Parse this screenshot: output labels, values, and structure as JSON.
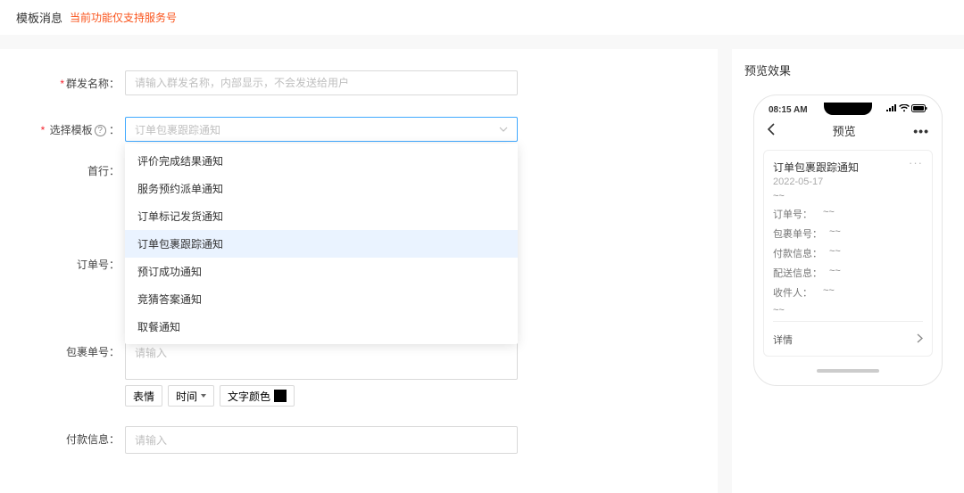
{
  "header": {
    "title": "模板消息",
    "note": "当前功能仅支持服务号"
  },
  "form": {
    "name_label": "群发名称：",
    "name_placeholder": "请输入群发名称，内部显示，不会发送给用户",
    "template_label": "选择模板",
    "template_placeholder": "订单包裹跟踪通知",
    "firstline_label": "首行：",
    "orderno_label": "订单号：",
    "packageno_label": "包裹单号：",
    "payment_label": "付款信息：",
    "textarea_placeholder": "请输入",
    "toolbar": {
      "emoji": "表情",
      "time": "时间",
      "color": "文字颜色"
    }
  },
  "dropdown": {
    "items": [
      {
        "label": "评价完成结果通知"
      },
      {
        "label": "服务预约派单通知"
      },
      {
        "label": "订单标记发货通知"
      },
      {
        "label": "订单包裹跟踪通知",
        "selected": true
      },
      {
        "label": "预订成功通知"
      },
      {
        "label": "竞猜答案通知"
      },
      {
        "label": "取餐通知"
      }
    ]
  },
  "preview": {
    "panel_title": "预览效果",
    "status_time": "08:15 AM",
    "top_title": "预览",
    "card_title": "订单包裹跟踪通知",
    "card_date": "2022-05-17",
    "tilde": "~~",
    "rows": [
      {
        "k": "订单号：",
        "v": "~~"
      },
      {
        "k": "包裹单号：",
        "v": "~~"
      },
      {
        "k": "付款信息：",
        "v": "~~"
      },
      {
        "k": "配送信息：",
        "v": "~~"
      },
      {
        "k": "收件人：",
        "v": "~~"
      }
    ],
    "footer_label": "详情"
  }
}
